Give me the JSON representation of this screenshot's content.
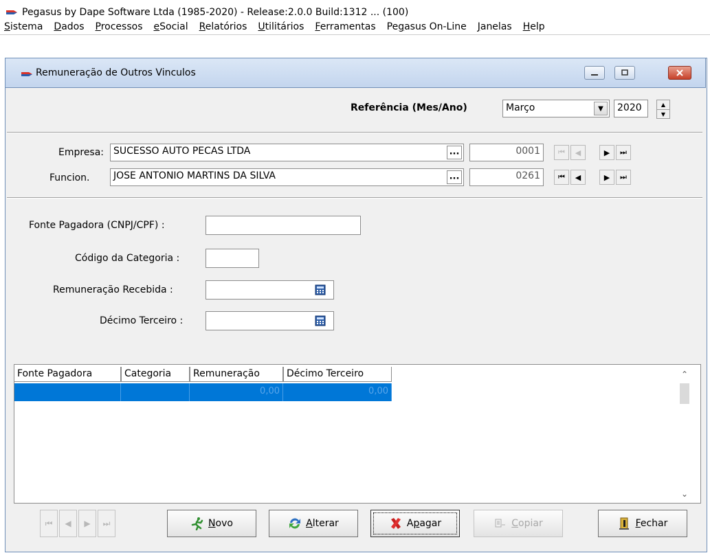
{
  "app": {
    "title": "Pegasus by Dape Software Ltda (1985-2020) - Release:2.0.0  Build:1312 ... (100)"
  },
  "menu": [
    "Sistema",
    "Dados",
    "Processos",
    "eSocial",
    "Relatórios",
    "Utilitários",
    "Ferramentas",
    "Pegasus On-Line",
    "Janelas",
    "Help"
  ],
  "window": {
    "title": "Remuneração de Outros Vinculos"
  },
  "referencia": {
    "label": "Referência (Mes/Ano)",
    "month": "Março",
    "year": "2020"
  },
  "empresa": {
    "label": "Empresa:",
    "name": "SUCESSO AUTO PECAS LTDA",
    "code": "0001"
  },
  "funcionario": {
    "label": "Funcion.",
    "name": "JOSE ANTONIO MARTINS DA SILVA",
    "code": "0261"
  },
  "form": {
    "fonte_label": "Fonte Pagadora (CNPJ/CPF) :",
    "fonte_value": "",
    "categoria_label": "Código da Categoria :",
    "categoria_value": "",
    "remuneracao_label": "Remuneração Recebida :",
    "remuneracao_value": "",
    "decimo_label": "Décimo Terceiro :",
    "decimo_value": ""
  },
  "grid": {
    "columns": [
      "Fonte Pagadora",
      "Categoria",
      "Remuneração",
      "Décimo Terceiro"
    ],
    "rows": [
      {
        "fonte": "",
        "categoria": "",
        "remuneracao": "0,00",
        "decimo": "0,00"
      }
    ]
  },
  "buttons": {
    "novo": "Novo",
    "alterar": "Alterar",
    "apagar": "Apagar",
    "copiar": "Copiar",
    "fechar": "Fechar"
  },
  "colors": {
    "selection": "#0077d7",
    "window_border": "#6f8fb8"
  }
}
